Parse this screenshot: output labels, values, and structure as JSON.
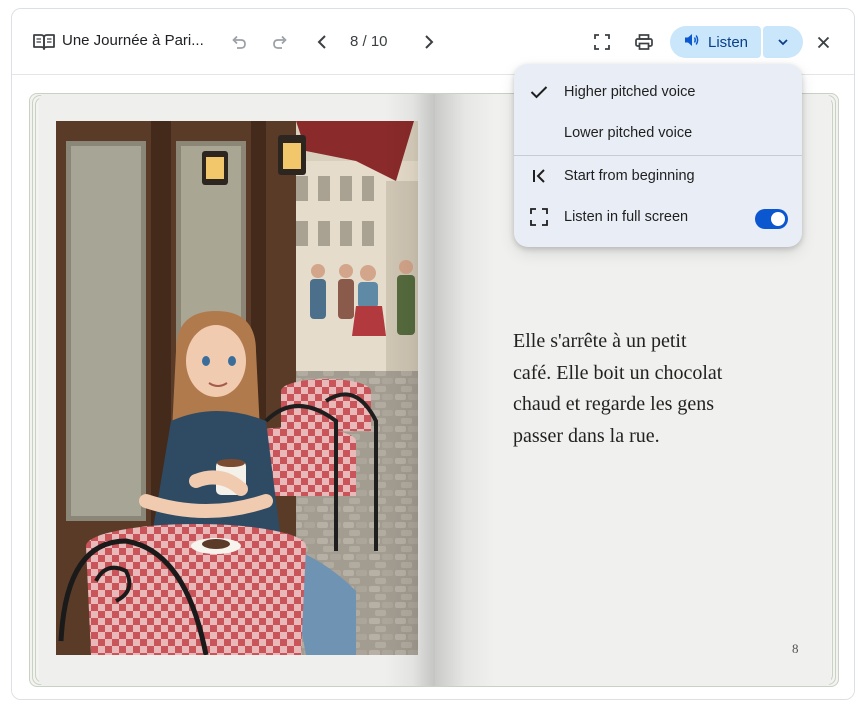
{
  "window": {
    "title": "Une Journée à Pari..."
  },
  "toolbar": {
    "page_indicator": "8 / 10",
    "listen_label": "Listen",
    "icons": [
      "book-icon",
      "undo-icon",
      "redo-icon",
      "chevron-left-icon",
      "chevron-right-icon",
      "fullscreen-icon",
      "print-icon",
      "speaker-icon",
      "chevron-down-icon",
      "close-icon"
    ]
  },
  "menu": {
    "items": [
      {
        "label": "Higher pitched voice",
        "checked": true,
        "icon": "check-icon"
      },
      {
        "label": "Lower pitched voice",
        "checked": false
      },
      {
        "label": "Start from beginning",
        "icon": "skip-to-start-icon"
      },
      {
        "label": "Listen in full screen",
        "icon": "fullscreen-icon",
        "toggle_on": true
      }
    ]
  },
  "book": {
    "text": "Elle s'arrête à un petit café. Elle boit un chocolat chaud et regarde les gens passer dans la rue.",
    "lines": [
      "Elle s'arrête à un petit",
      "café. Elle boit un chocolat",
      "chaud et regarde les gens",
      "passer dans la rue."
    ],
    "page_number": "8",
    "illustration": "girl-drinking-hot-chocolate-at-paris-cafe"
  },
  "colors": {
    "accent": "#0b57d0",
    "listen_bg": "#c9e6fb",
    "menu_bg": "#e9eef6"
  }
}
